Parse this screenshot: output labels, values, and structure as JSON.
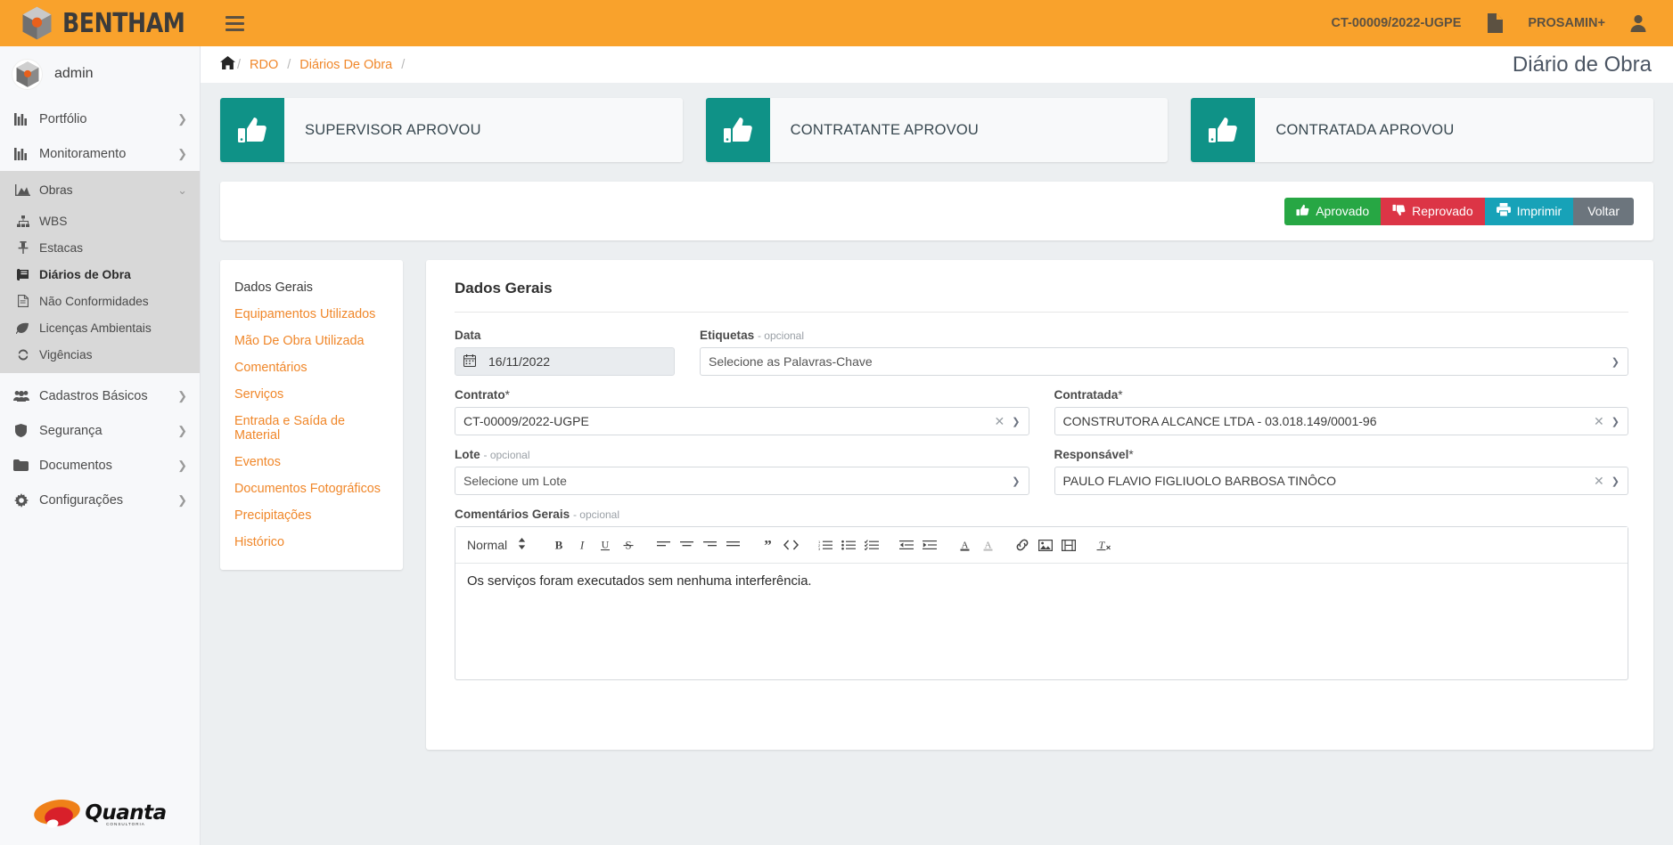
{
  "topbar": {
    "brand": "BENTHAM",
    "logo_icon": "cube-logo-icon",
    "menu_icon": "hamburger-menu-icon",
    "contract": "CT-00009/2022-UGPE",
    "document_icon": "document-icon",
    "project": "PROSAMIN+",
    "user_icon": "user-account-icon",
    "bg_color": "#f9a22c"
  },
  "sidebar": {
    "user": {
      "name": "admin",
      "avatar_icon": "cube-avatar-icon"
    },
    "items": [
      {
        "label": "Portfólio",
        "icon": "chart-bar-icon",
        "chevron": "chevron-right",
        "expanded": false
      },
      {
        "label": "Monitoramento",
        "icon": "chart-bar-icon",
        "chevron": "chevron-right",
        "expanded": false
      },
      {
        "label": "Obras",
        "icon": "mountain-chart-icon",
        "chevron": "chevron-down",
        "expanded": true
      },
      {
        "label": "Cadastros Básicos",
        "icon": "users-group-icon",
        "chevron": "chevron-right",
        "expanded": false
      },
      {
        "label": "Segurança",
        "icon": "shield-icon",
        "chevron": "chevron-right",
        "expanded": false
      },
      {
        "label": "Documentos",
        "icon": "folder-icon",
        "chevron": "chevron-right",
        "expanded": false
      },
      {
        "label": "Configurações",
        "icon": "gear-icon",
        "chevron": "chevron-right",
        "expanded": false
      }
    ],
    "obras_children": [
      {
        "label": "WBS",
        "icon": "sitemap-icon",
        "active": false
      },
      {
        "label": "Estacas",
        "icon": "pin-icon",
        "active": false
      },
      {
        "label": "Diários de Obra",
        "icon": "book-icon",
        "active": true
      },
      {
        "label": "Não Conformidades",
        "icon": "file-text-icon",
        "active": false
      },
      {
        "label": "Licenças Ambientais",
        "icon": "leaf-icon",
        "active": false
      },
      {
        "label": "Vigências",
        "icon": "refresh-icon",
        "active": false
      }
    ],
    "footer_logo": {
      "text": "Quanta",
      "subtitle": "CONSULTORIA",
      "registered": "®"
    }
  },
  "breadcrumb": {
    "home_icon": "home-icon",
    "items": [
      "RDO",
      "Diários De Obra"
    ],
    "separator": "/"
  },
  "page": {
    "title": "Diário de Obra"
  },
  "approval_cards": [
    {
      "label": "SUPERVISOR APROVOU",
      "icon": "thumbs-up-icon",
      "color": "#0f9287"
    },
    {
      "label": "CONTRATANTE APROVOU",
      "icon": "thumbs-up-icon",
      "color": "#0f9287"
    },
    {
      "label": "CONTRATADA APROVOU",
      "icon": "thumbs-up-icon",
      "color": "#0f9287"
    }
  ],
  "actions": [
    {
      "label": "Aprovado",
      "icon": "thumbs-up-icon",
      "color": "#27a744"
    },
    {
      "label": "Reprovado",
      "icon": "thumbs-down-icon",
      "color": "#dc3546"
    },
    {
      "label": "Imprimir",
      "icon": "printer-icon",
      "color": "#17a2b8"
    },
    {
      "label": "Voltar",
      "icon": "",
      "color": "#6c757d"
    }
  ],
  "tabs": [
    {
      "label": "Dados Gerais",
      "active": true
    },
    {
      "label": "Equipamentos Utilizados",
      "active": false
    },
    {
      "label": "Mão De Obra Utilizada",
      "active": false
    },
    {
      "label": "Comentários",
      "active": false
    },
    {
      "label": "Serviços",
      "active": false
    },
    {
      "label": "Entrada e Saída de Material",
      "active": false
    },
    {
      "label": "Eventos",
      "active": false
    },
    {
      "label": "Documentos Fotográficos",
      "active": false
    },
    {
      "label": "Precipitações",
      "active": false
    },
    {
      "label": "Histórico",
      "active": false
    }
  ],
  "form": {
    "title": "Dados Gerais",
    "data": {
      "label": "Data",
      "value": "16/11/2022",
      "icon": "calendar-icon"
    },
    "etiquetas": {
      "label": "Etiquetas",
      "optional": "- opcional",
      "value": "Selecione as Palavras-Chave"
    },
    "contrato": {
      "label": "Contrato",
      "required": "*",
      "value": "CT-00009/2022-UGPE"
    },
    "contratada": {
      "label": "Contratada",
      "required": "*",
      "value": "CONSTRUTORA ALCANCE LTDA - 03.018.149/0001-96"
    },
    "lote": {
      "label": "Lote",
      "optional": "- opcional",
      "value": "Selecione um Lote"
    },
    "responsavel": {
      "label": "Responsável",
      "required": "*",
      "value": "PAULO FLAVIO FIGLIUOLO BARBOSA TINÔCO"
    },
    "comentarios": {
      "label": "Comentários Gerais",
      "optional": "- opcional",
      "format_picker": "Normal",
      "content": "Os serviços foram executados sem nenhuma interferência."
    }
  }
}
